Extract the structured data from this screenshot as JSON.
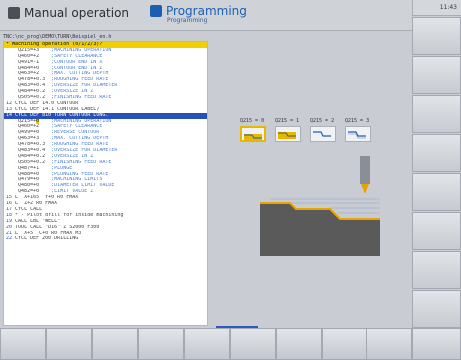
{
  "header": {
    "left_mode": "Manual operation",
    "right_mode": "Programming",
    "right_mode_sub": "Programming",
    "clock": "11:43"
  },
  "path": "TNC:\\nc_prog\\DEMO\\TURN\\Beispiel_en.h",
  "program": {
    "lines": [
      {
        "num": "",
        "text": "* Machining operation (0/1/2/3)?",
        "style": "yellow"
      },
      {
        "num": "",
        "text": "    Q215=+3    ",
        "comment": ";MACHINING OPERATION",
        "style": ""
      },
      {
        "num": "",
        "text": "    Q460=+2    ",
        "comment": ";SAFETY CLEARANCE",
        "style": ""
      },
      {
        "num": "",
        "text": "    Q491=-1    ",
        "comment": ";CONTOUR END IN X",
        "style": ""
      },
      {
        "num": "",
        "text": "    Q484=+0    ",
        "comment": ";CONTOUR END IN Z",
        "style": ""
      },
      {
        "num": "",
        "text": "    Q463=+2    ",
        "comment": ";MAX. CUTTING DEPTH",
        "style": ""
      },
      {
        "num": "",
        "text": "    Q478=+0.3  ",
        "comment": ";ROUGHING FEED RATE",
        "style": ""
      },
      {
        "num": "",
        "text": "    Q483=+0.4  ",
        "comment": ";OVERSIZE FOR DIAMETER",
        "style": ""
      },
      {
        "num": "",
        "text": "    Q484=+0.2  ",
        "comment": ";OVERSIZE IN Z",
        "style": ""
      },
      {
        "num": "",
        "text": "    Q505=+0.2  ",
        "comment": ";FINISHING FEED RATE",
        "style": ""
      },
      {
        "num": "12",
        "text": " CYCL DEF 14.0 CONTOUR",
        "comment": "",
        "style": ""
      },
      {
        "num": "13",
        "text": " CYCL DEF 14.1 CONTOUR LABEL7",
        "comment": "",
        "style": ""
      },
      {
        "num": "14",
        "text": " CYCL DEF 810 TURN CONTOUR LONG.",
        "comment": "",
        "style": "blue"
      },
      {
        "num": "",
        "text": "    Q215=+",
        "cell": "0",
        "comment": "    ;MACHINING OPERATION",
        "style": "cursor"
      },
      {
        "num": "",
        "text": "    Q460=+2    ",
        "comment": ";SAFETY CLEARANCE",
        "style": ""
      },
      {
        "num": "",
        "text": "    Q499=+0    ",
        "comment": ";REVERSE CONTOUR",
        "style": ""
      },
      {
        "num": "",
        "text": "    Q463=+3    ",
        "comment": ";MAX. CUTTING DEPTH",
        "style": ""
      },
      {
        "num": "",
        "text": "    Q478=+0.3  ",
        "comment": ";ROUGHING FEED RATE",
        "style": ""
      },
      {
        "num": "",
        "text": "    Q483=+0.4  ",
        "comment": ";OVERSIZE FOR DIAMETER",
        "style": ""
      },
      {
        "num": "",
        "text": "    Q484=+0.2  ",
        "comment": ";OVERSIZE IN Z",
        "style": ""
      },
      {
        "num": "",
        "text": "    Q505=+0.2  ",
        "comment": ";FINISHING FEED RATE",
        "style": ""
      },
      {
        "num": "",
        "text": "    Q487=+1    ",
        "comment": ";PLUNGE",
        "style": ""
      },
      {
        "num": "",
        "text": "    Q488=+0    ",
        "comment": ";PLUNGING FEED RATE",
        "style": ""
      },
      {
        "num": "",
        "text": "    Q479=+0    ",
        "comment": ";MACHINING LIMITS",
        "style": ""
      },
      {
        "num": "",
        "text": "    Q480=+0    ",
        "comment": ";DIAMETER LIMIT VALUE",
        "style": ""
      },
      {
        "num": "",
        "text": "    Q482=+0    ",
        "comment": ";LIMIT VALUE Z",
        "style": ""
      },
      {
        "num": "15",
        "text": " L  X+165  Y+0 R0 FMAX",
        "comment": "",
        "style": ""
      },
      {
        "num": "16",
        "text": " L  Z+2 R0 FMAX",
        "comment": "",
        "style": ""
      },
      {
        "num": "17",
        "text": " CYCL CALL",
        "comment": "",
        "style": ""
      },
      {
        "num": "18",
        "text": " * - Pilot drill for inside machining",
        "comment": "",
        "style": ""
      },
      {
        "num": "19",
        "text": " CALL LBL \"WELL\"",
        "comment": "",
        "style": ""
      },
      {
        "num": "20",
        "text": " TOOL CALL \"D16\" Z S2000 F300",
        "comment": "",
        "style": ""
      },
      {
        "num": "21",
        "text": " L  X+5  C+0 R0 FMAX M3",
        "comment": "",
        "style": ""
      },
      {
        "num": "22",
        "text": " CYCL DEF 200 DRILLING",
        "comment": "",
        "style": ""
      }
    ]
  },
  "options": [
    {
      "label": "Q215 = 0",
      "selected": true
    },
    {
      "label": "Q215 = 1",
      "selected": false
    },
    {
      "label": "Q215 = 2",
      "selected": false
    },
    {
      "label": "Q215 = 3",
      "selected": false
    }
  ],
  "colors": {
    "highlight": "#f2d000",
    "selection": "#2950b8",
    "workpiece": "#5a5a5a",
    "contour": "#e8a300",
    "toolpath": "#8ba2c4"
  }
}
